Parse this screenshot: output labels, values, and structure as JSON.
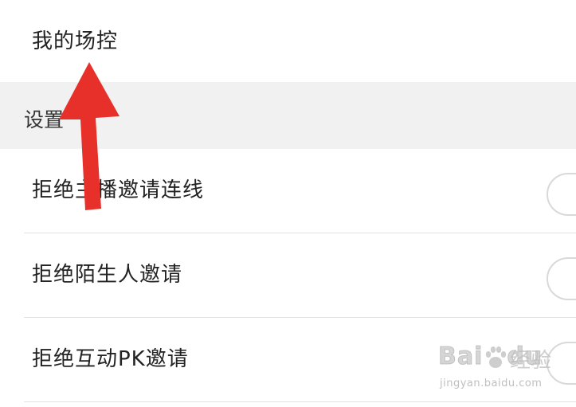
{
  "my_field_control": {
    "label": "我的场控"
  },
  "settings_section": {
    "title": "设置",
    "items": [
      {
        "label": "拒绝主播邀请连线",
        "toggle_on": false
      },
      {
        "label": "拒绝陌生人邀请",
        "toggle_on": false
      },
      {
        "label": "拒绝互动PK邀请",
        "toggle_on": false
      }
    ]
  },
  "annotation": {
    "arrow_color": "#e8302b"
  },
  "watermark": {
    "brand": "Bai",
    "brand_suffix": "du",
    "cn": "经验",
    "url": "jingyan.baidu.com"
  },
  "colors": {
    "section_bg": "#f1f1f1",
    "divider": "#e2e2e2",
    "text": "#222222"
  }
}
